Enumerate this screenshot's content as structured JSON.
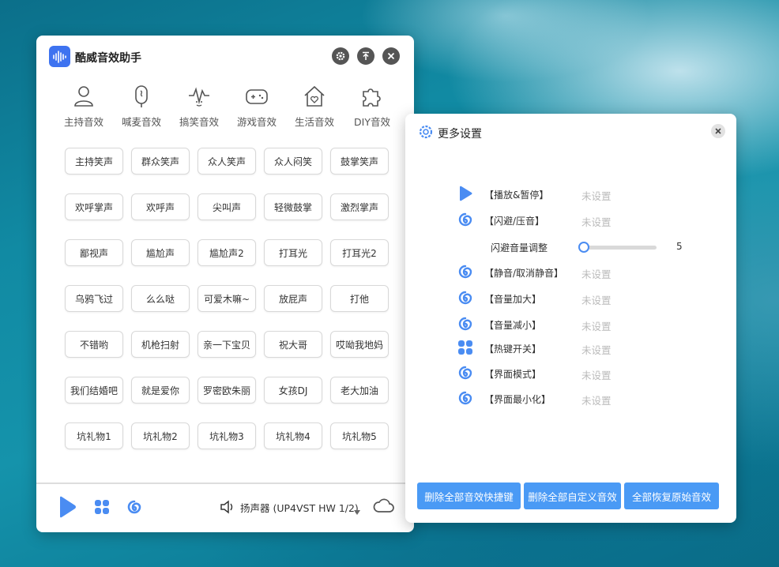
{
  "main": {
    "title": "酷威音效助手",
    "categories": [
      {
        "label": "主持音效",
        "icon": "person-icon"
      },
      {
        "label": "喊麦音效",
        "icon": "microphone-icon"
      },
      {
        "label": "搞笑音效",
        "icon": "wave-face-icon"
      },
      {
        "label": "游戏音效",
        "icon": "gamepad-icon"
      },
      {
        "label": "生活音效",
        "icon": "home-heart-icon"
      },
      {
        "label": "DIY音效",
        "icon": "puzzle-icon"
      }
    ],
    "sounds": [
      [
        "主持笑声",
        "群众笑声",
        "众人笑声",
        "众人闷笑",
        "鼓掌笑声"
      ],
      [
        "欢呼掌声",
        "欢呼声",
        "尖叫声",
        "轻微鼓掌",
        "激烈掌声"
      ],
      [
        "鄙视声",
        "尴尬声",
        "尴尬声2",
        "打耳光",
        "打耳光2"
      ],
      [
        "乌鸦飞过",
        "么么哒",
        "可爱木嘛~",
        "放屁声",
        "打他"
      ],
      [
        "不错哟",
        "机枪扫射",
        "亲一下宝贝",
        "祝大哥",
        "哎呦我地妈"
      ],
      [
        "我们结婚吧",
        "就是爱你",
        "罗密欧朱丽",
        "女孩DJ",
        "老大加油"
      ],
      [
        "坑礼物1",
        "坑礼物2",
        "坑礼物3",
        "坑礼物4",
        "坑礼物5"
      ]
    ],
    "speaker": "扬声器 (UP4VST HW 1/2)"
  },
  "settings": {
    "title": "更多设置",
    "rows": [
      {
        "label": "【播放&暂停】",
        "value": "未设置",
        "icon": "play-icon"
      },
      {
        "label": "【闪避/压音】",
        "value": "未设置",
        "icon": "swirl-icon"
      },
      {
        "label": "【静音/取消静音】",
        "value": "未设置",
        "icon": "swirl-icon"
      },
      {
        "label": "【音量加大】",
        "value": "未设置",
        "icon": "swirl-icon"
      },
      {
        "label": "【音量减小】",
        "value": "未设置",
        "icon": "swirl-icon"
      },
      {
        "label": "【热键开关】",
        "value": "未设置",
        "icon": "grid-icon"
      },
      {
        "label": "【界面模式】",
        "value": "未设置",
        "icon": "swirl-icon"
      },
      {
        "label": "【界面最小化】",
        "value": "未设置",
        "icon": "swirl-icon"
      }
    ],
    "duck_label": "闪避音量调整",
    "duck_value": "5",
    "actions": [
      "删除全部音效快捷键",
      "删除全部自定义音效",
      "全部恢复原始音效"
    ]
  },
  "colors": {
    "accent": "#4a8cf2",
    "button_blue": "#4a9af5",
    "logo": "#3e73f0"
  }
}
